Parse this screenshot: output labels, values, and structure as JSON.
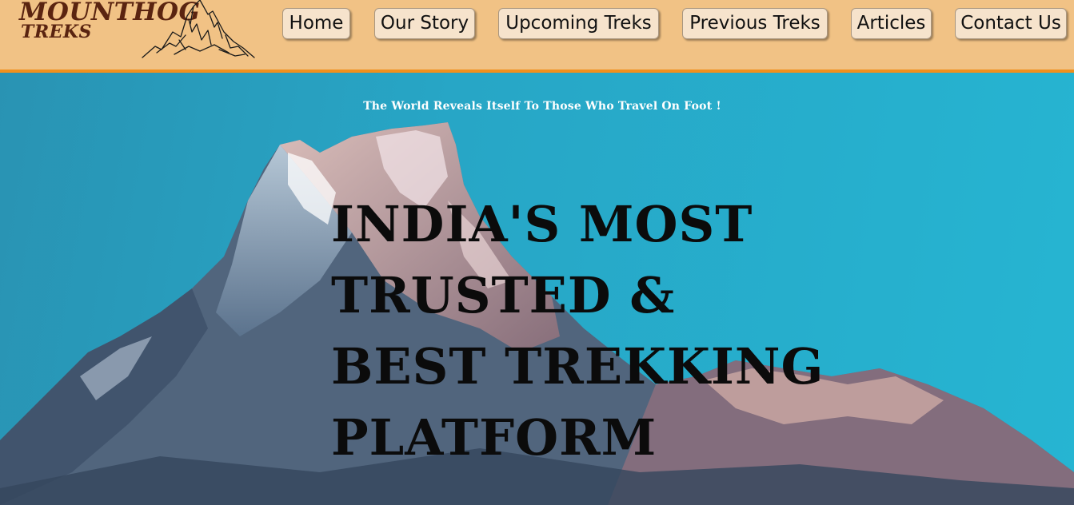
{
  "brand": {
    "name_line1": "MOUNTHOG",
    "name_line2": "TREKS",
    "text_color": "#5a2410",
    "icon": "mountain-sketch-icon"
  },
  "nav": {
    "background": "#f1c285",
    "border_color": "#f0901d",
    "items": [
      {
        "label": "Home"
      },
      {
        "label": "Our Story"
      },
      {
        "label": "Upcoming Treks"
      },
      {
        "label": "Previous Treks"
      },
      {
        "label": "Articles"
      },
      {
        "label": "Contact Us"
      }
    ]
  },
  "hero": {
    "tagline": "The World Reveals Itself To Those Who Travel On Foot !",
    "headline_lines": [
      "INDIA'S MOST",
      "TRUSTED &",
      "BEST TREKKING",
      "PLATFORM"
    ],
    "sky_color": "#27a6c6"
  }
}
